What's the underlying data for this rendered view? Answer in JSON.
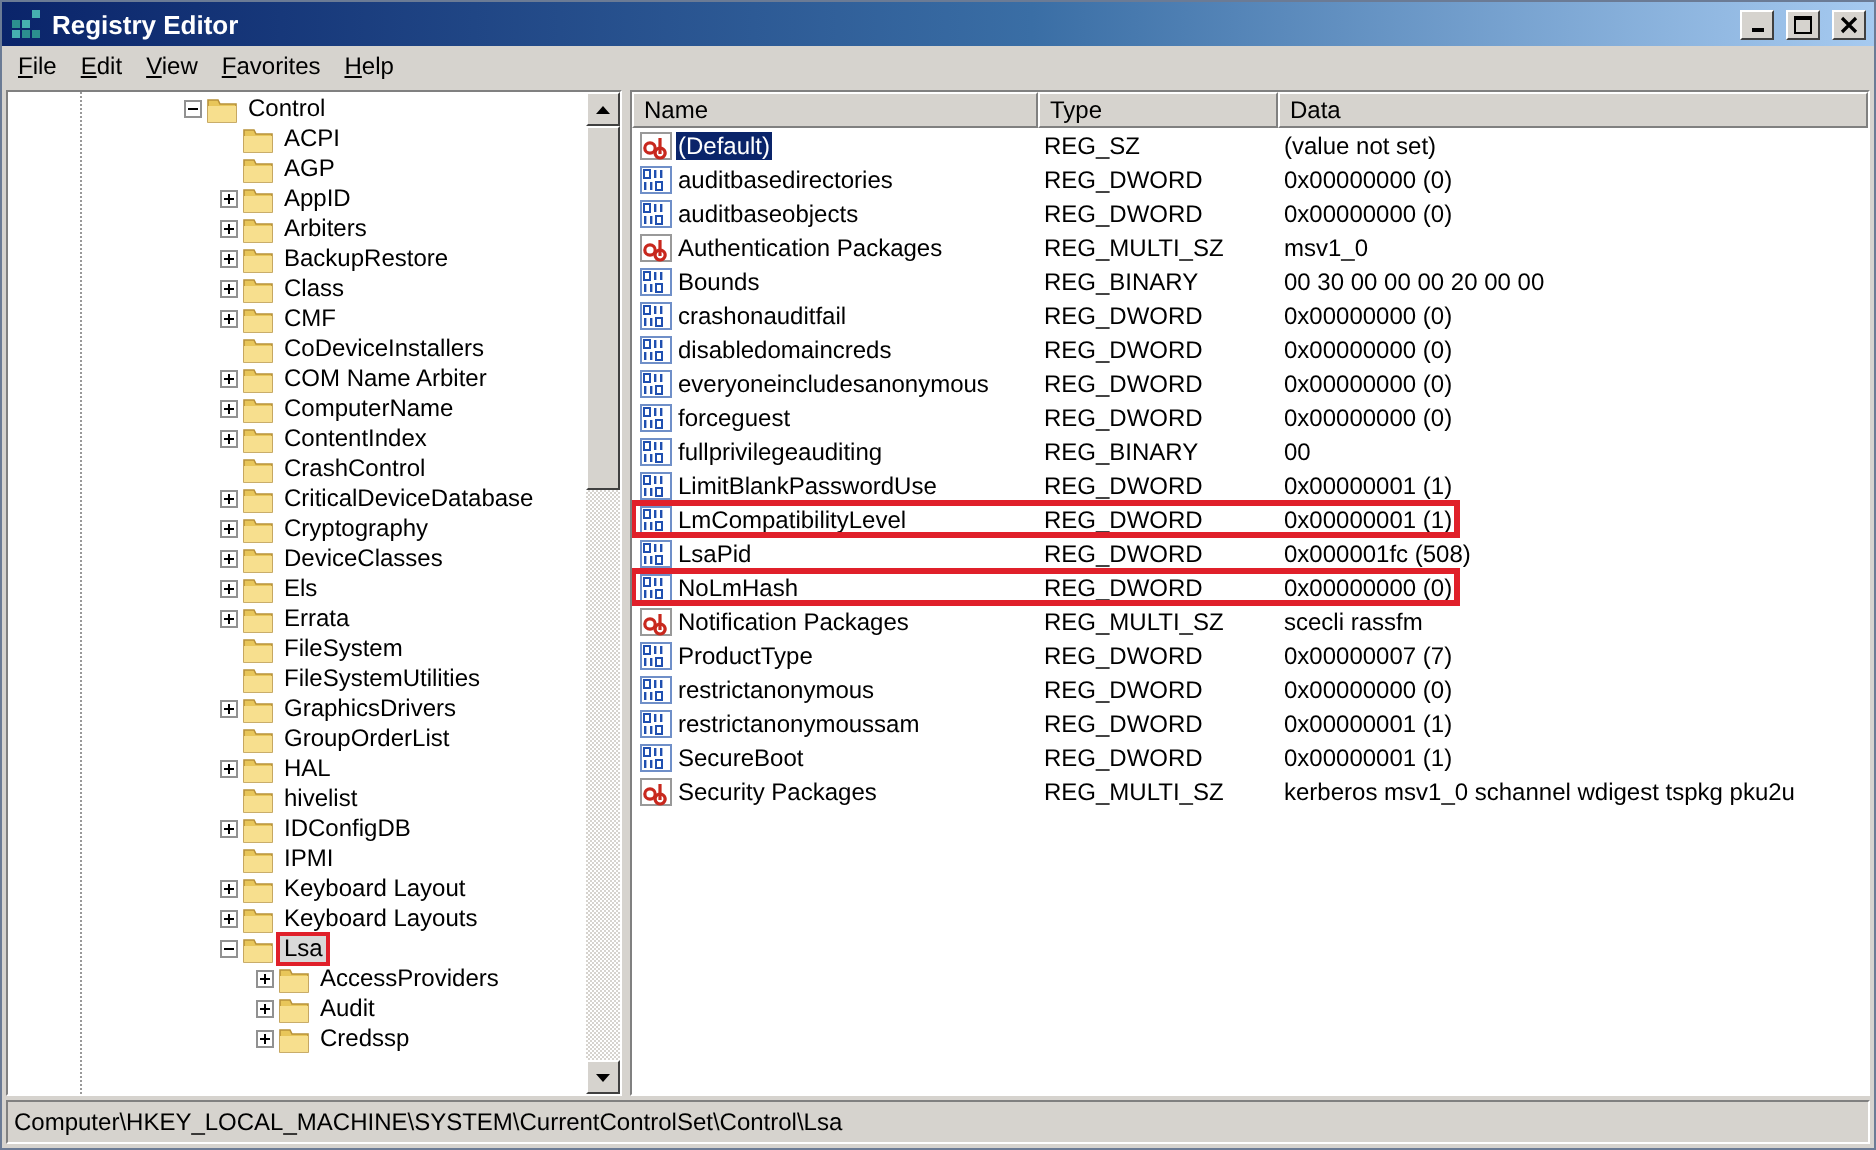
{
  "window": {
    "title": "Registry Editor",
    "controls": [
      {
        "kind": "minimize"
      },
      {
        "kind": "maximize"
      },
      {
        "kind": "close"
      }
    ]
  },
  "menu": [
    {
      "label": "File"
    },
    {
      "label": "Edit"
    },
    {
      "label": "View"
    },
    {
      "label": "Favorites"
    },
    {
      "label": "Help"
    }
  ],
  "tree": [
    {
      "label": "Control",
      "kind": "branch",
      "expanded": true,
      "selected": false,
      "highlighted": false,
      "children": [
        {
          "label": "ACPI",
          "kind": "leaf",
          "selected": false,
          "highlighted": false
        },
        {
          "label": "AGP",
          "kind": "leaf",
          "selected": false,
          "highlighted": false
        },
        {
          "label": "AppID",
          "kind": "branch",
          "expanded": false,
          "selected": false,
          "highlighted": false
        },
        {
          "label": "Arbiters",
          "kind": "branch",
          "expanded": false,
          "selected": false,
          "highlighted": false
        },
        {
          "label": "BackupRestore",
          "kind": "branch",
          "expanded": false,
          "selected": false,
          "highlighted": false
        },
        {
          "label": "Class",
          "kind": "branch",
          "expanded": false,
          "selected": false,
          "highlighted": false
        },
        {
          "label": "CMF",
          "kind": "branch",
          "expanded": false,
          "selected": false,
          "highlighted": false
        },
        {
          "label": "CoDeviceInstallers",
          "kind": "leaf",
          "selected": false,
          "highlighted": false
        },
        {
          "label": "COM Name Arbiter",
          "kind": "branch",
          "expanded": false,
          "selected": false,
          "highlighted": false
        },
        {
          "label": "ComputerName",
          "kind": "branch",
          "expanded": false,
          "selected": false,
          "highlighted": false
        },
        {
          "label": "ContentIndex",
          "kind": "branch",
          "expanded": false,
          "selected": false,
          "highlighted": false
        },
        {
          "label": "CrashControl",
          "kind": "leaf",
          "selected": false,
          "highlighted": false
        },
        {
          "label": "CriticalDeviceDatabase",
          "kind": "branch",
          "expanded": false,
          "selected": false,
          "highlighted": false
        },
        {
          "label": "Cryptography",
          "kind": "branch",
          "expanded": false,
          "selected": false,
          "highlighted": false
        },
        {
          "label": "DeviceClasses",
          "kind": "branch",
          "expanded": false,
          "selected": false,
          "highlighted": false
        },
        {
          "label": "Els",
          "kind": "branch",
          "expanded": false,
          "selected": false,
          "highlighted": false
        },
        {
          "label": "Errata",
          "kind": "branch",
          "expanded": false,
          "selected": false,
          "highlighted": false
        },
        {
          "label": "FileSystem",
          "kind": "leaf",
          "selected": false,
          "highlighted": false
        },
        {
          "label": "FileSystemUtilities",
          "kind": "leaf",
          "selected": false,
          "highlighted": false
        },
        {
          "label": "GraphicsDrivers",
          "kind": "branch",
          "expanded": false,
          "selected": false,
          "highlighted": false
        },
        {
          "label": "GroupOrderList",
          "kind": "leaf",
          "selected": false,
          "highlighted": false
        },
        {
          "label": "HAL",
          "kind": "branch",
          "expanded": false,
          "selected": false,
          "highlighted": false
        },
        {
          "label": "hivelist",
          "kind": "leaf",
          "selected": false,
          "highlighted": false
        },
        {
          "label": "IDConfigDB",
          "kind": "branch",
          "expanded": false,
          "selected": false,
          "highlighted": false
        },
        {
          "label": "IPMI",
          "kind": "leaf",
          "selected": false,
          "highlighted": false
        },
        {
          "label": "Keyboard Layout",
          "kind": "branch",
          "expanded": false,
          "selected": false,
          "highlighted": false
        },
        {
          "label": "Keyboard Layouts",
          "kind": "branch",
          "expanded": false,
          "selected": false,
          "highlighted": false
        },
        {
          "label": "Lsa",
          "kind": "branch",
          "expanded": true,
          "selected": true,
          "highlighted": true,
          "children": [
            {
              "label": "AccessProviders",
              "kind": "branch",
              "expanded": false,
              "selected": false,
              "highlighted": false
            },
            {
              "label": "Audit",
              "kind": "branch",
              "expanded": false,
              "selected": false,
              "highlighted": false
            },
            {
              "label": "Credssp",
              "kind": "branch",
              "expanded": false,
              "selected": false,
              "highlighted": false
            }
          ]
        }
      ]
    }
  ],
  "table": {
    "columns": [
      "Name",
      "Type",
      "Data"
    ],
    "rows": [
      {
        "kind": "string",
        "name": "(Default)",
        "type": "REG_SZ",
        "data": "(value not set)",
        "selected": true,
        "highlighted": false
      },
      {
        "kind": "binary",
        "name": "auditbasedirectories",
        "type": "REG_DWORD",
        "data": "0x00000000 (0)",
        "selected": false,
        "highlighted": false
      },
      {
        "kind": "binary",
        "name": "auditbaseobjects",
        "type": "REG_DWORD",
        "data": "0x00000000 (0)",
        "selected": false,
        "highlighted": false
      },
      {
        "kind": "string",
        "name": "Authentication Packages",
        "type": "REG_MULTI_SZ",
        "data": "msv1_0",
        "selected": false,
        "highlighted": false
      },
      {
        "kind": "binary",
        "name": "Bounds",
        "type": "REG_BINARY",
        "data": "00 30 00 00 00 20 00 00",
        "selected": false,
        "highlighted": false
      },
      {
        "kind": "binary",
        "name": "crashonauditfail",
        "type": "REG_DWORD",
        "data": "0x00000000 (0)",
        "selected": false,
        "highlighted": false
      },
      {
        "kind": "binary",
        "name": "disabledomaincreds",
        "type": "REG_DWORD",
        "data": "0x00000000 (0)",
        "selected": false,
        "highlighted": false
      },
      {
        "kind": "binary",
        "name": "everyoneincludesanonymous",
        "type": "REG_DWORD",
        "data": "0x00000000 (0)",
        "selected": false,
        "highlighted": false
      },
      {
        "kind": "binary",
        "name": "forceguest",
        "type": "REG_DWORD",
        "data": "0x00000000 (0)",
        "selected": false,
        "highlighted": false
      },
      {
        "kind": "binary",
        "name": "fullprivilegeauditing",
        "type": "REG_BINARY",
        "data": "00",
        "selected": false,
        "highlighted": false
      },
      {
        "kind": "binary",
        "name": "LimitBlankPasswordUse",
        "type": "REG_DWORD",
        "data": "0x00000001 (1)",
        "selected": false,
        "highlighted": false
      },
      {
        "kind": "binary",
        "name": "LmCompatibilityLevel",
        "type": "REG_DWORD",
        "data": "0x00000001 (1)",
        "selected": false,
        "highlighted": true
      },
      {
        "kind": "binary",
        "name": "LsaPid",
        "type": "REG_DWORD",
        "data": "0x000001fc (508)",
        "selected": false,
        "highlighted": false
      },
      {
        "kind": "binary",
        "name": "NoLmHash",
        "type": "REG_DWORD",
        "data": "0x00000000 (0)",
        "selected": false,
        "highlighted": true
      },
      {
        "kind": "string",
        "name": "Notification Packages",
        "type": "REG_MULTI_SZ",
        "data": "scecli rassfm",
        "selected": false,
        "highlighted": false
      },
      {
        "kind": "binary",
        "name": "ProductType",
        "type": "REG_DWORD",
        "data": "0x00000007 (7)",
        "selected": false,
        "highlighted": false
      },
      {
        "kind": "binary",
        "name": "restrictanonymous",
        "type": "REG_DWORD",
        "data": "0x00000000 (0)",
        "selected": false,
        "highlighted": false
      },
      {
        "kind": "binary",
        "name": "restrictanonymoussam",
        "type": "REG_DWORD",
        "data": "0x00000001 (1)",
        "selected": false,
        "highlighted": false
      },
      {
        "kind": "binary",
        "name": "SecureBoot",
        "type": "REG_DWORD",
        "data": "0x00000001 (1)",
        "selected": false,
        "highlighted": false
      },
      {
        "kind": "string",
        "name": "Security Packages",
        "type": "REG_MULTI_SZ",
        "data": "kerberos msv1_0 schannel wdigest tspkg pku2u",
        "selected": false,
        "highlighted": false
      }
    ]
  },
  "status_bar": "Computer\\HKEY_LOCAL_MACHINE\\SYSTEM\\CurrentControlSet\\Control\\Lsa"
}
